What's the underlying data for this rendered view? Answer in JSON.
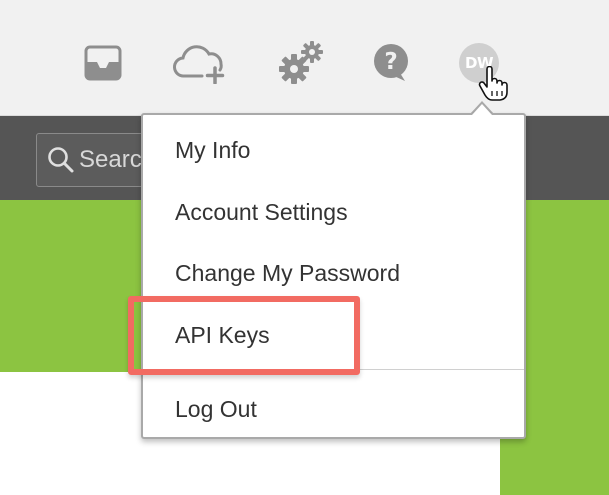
{
  "toolbar": {
    "icons": [
      "inbox-icon",
      "cloud-upload-icon",
      "gears-icon",
      "help-icon"
    ],
    "avatar_initials": "DW"
  },
  "search": {
    "placeholder": "Search"
  },
  "user_menu": {
    "items": [
      {
        "label": "My Info"
      },
      {
        "label": "Account Settings"
      },
      {
        "label": "Change My Password"
      },
      {
        "label": "API Keys",
        "highlighted": true
      },
      {
        "label": "Log Out"
      }
    ]
  },
  "colors": {
    "topbar": "#f1f1f1",
    "darkbar": "#555555",
    "green_banner": "#8cc441",
    "icon_gray": "#8e8e8e",
    "highlight": "#f26b62"
  }
}
